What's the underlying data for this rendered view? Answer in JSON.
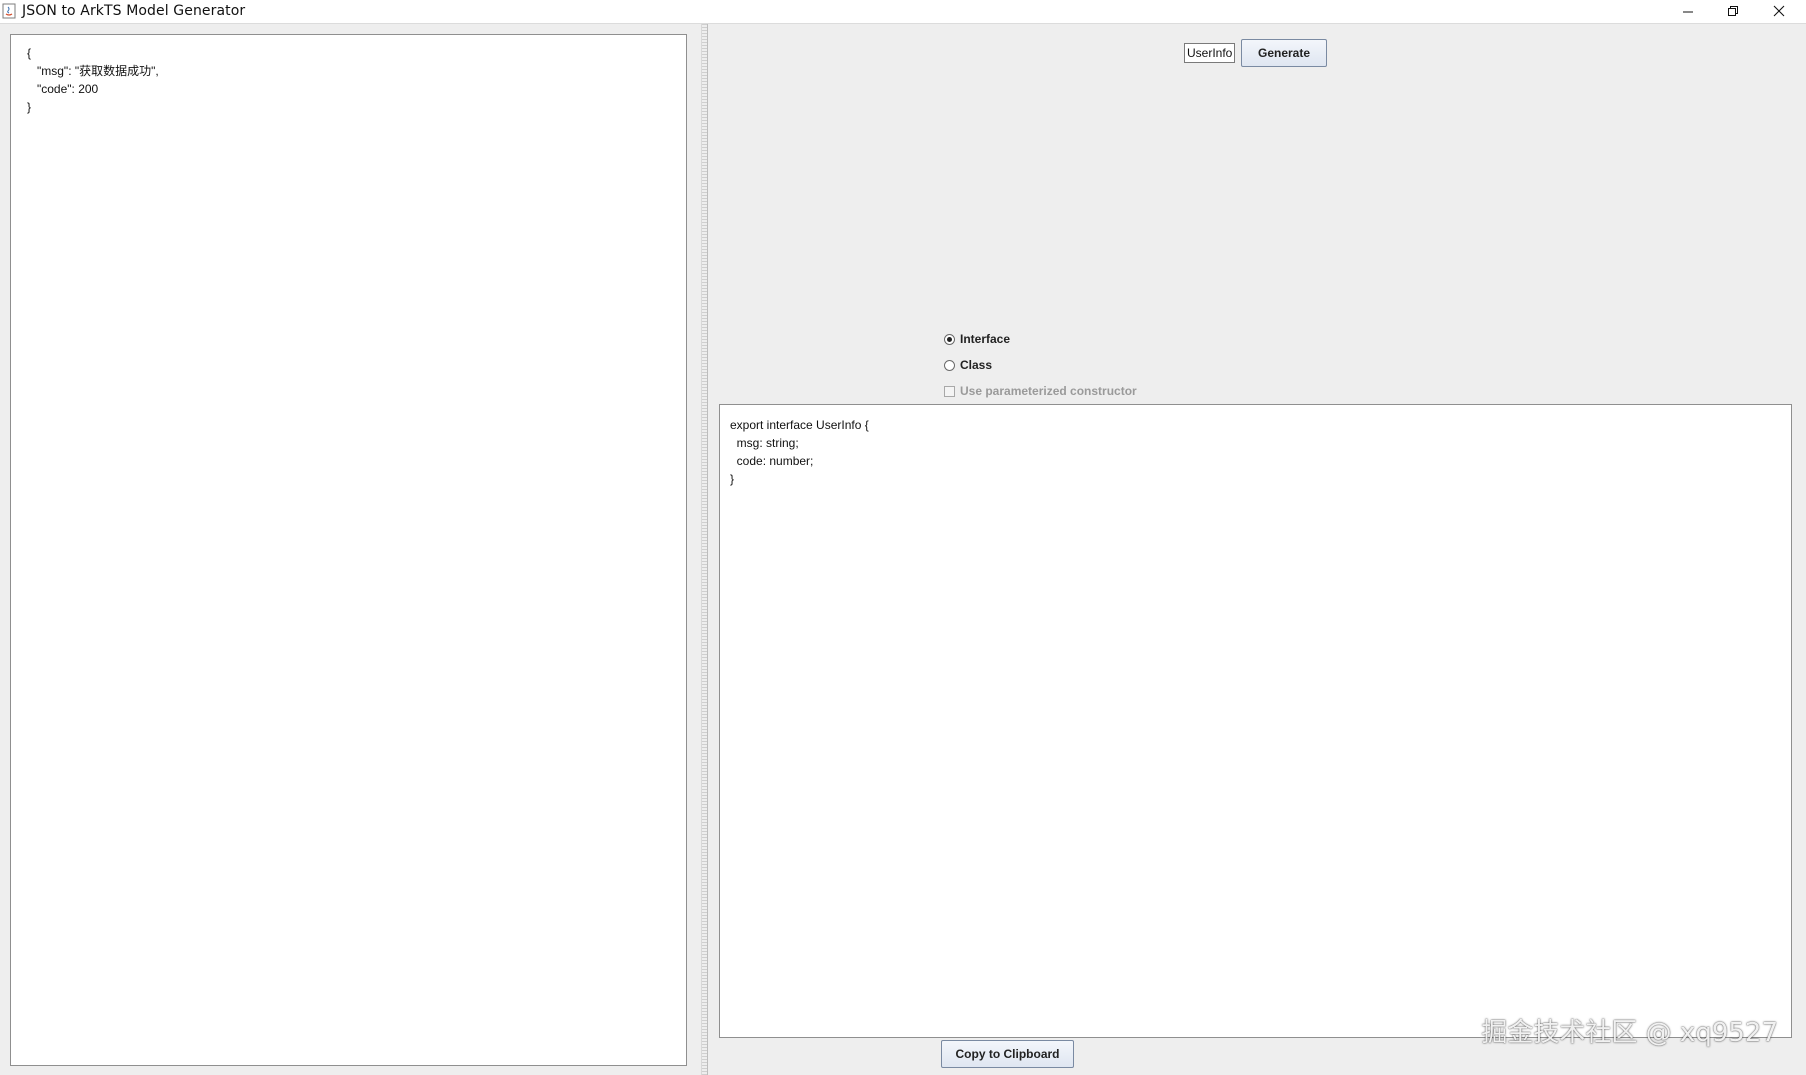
{
  "window": {
    "title": "JSON to ArkTS Model Generator",
    "controls": {
      "minimize_icon": "minimize-icon",
      "maximize_icon": "restore-icon",
      "close_icon": "close-icon"
    }
  },
  "input": {
    "json_text": "{\n   \"msg\": \"获取数据成功\",\n   \"code\": 200\n}"
  },
  "toolbar": {
    "class_name_value": "UserInfo",
    "generate_label": "Generate"
  },
  "options": {
    "interface_label": "Interface",
    "interface_selected": true,
    "class_label": "Class",
    "class_selected": false,
    "constructor_label": "Use parameterized constructor",
    "constructor_checked": false,
    "constructor_enabled": false
  },
  "output": {
    "code_text": "export interface UserInfo {\n  msg: string;\n  code: number;\n}"
  },
  "footer": {
    "copy_label": "Copy to Clipboard"
  },
  "watermark": {
    "text": "掘金技术社区 @ xq9527"
  },
  "colors": {
    "window_bg": "#eeeeee",
    "text_area_bg": "#ffffff",
    "button_border": "#7a8aa2"
  }
}
